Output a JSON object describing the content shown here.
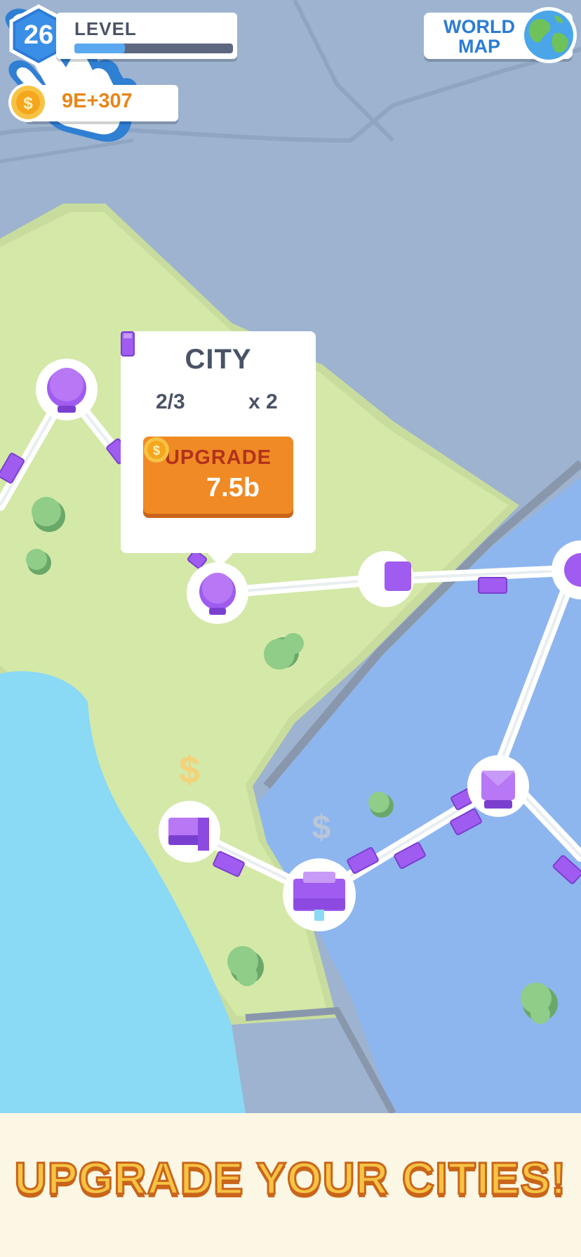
{
  "hud": {
    "level_number": "26",
    "level_label": "LEVEL",
    "level_progress": 0.32,
    "coins": "9E+307",
    "world_map_line1": "WORLD",
    "world_map_line2": "MAP"
  },
  "popup": {
    "title": "CITY",
    "progress": "2/3",
    "multiplier": "x 2",
    "upgrade_label": "UPGRADE",
    "upgrade_cost": "7.5b"
  },
  "banner": {
    "text": "UPGRADE YOUR CITIES!"
  },
  "colors": {
    "land": "#cfe6a5",
    "water_light": "#8ad9f5",
    "water_blue": "#8db6ef",
    "sea": "#9db3cf",
    "node_purple": "#a05cf0",
    "coin": "#f6a61c",
    "upgrade_button": "#f08a24"
  },
  "icons": [
    "coin-icon",
    "globe-icon",
    "truck-icon",
    "hand-pointer-icon",
    "dollar-icon",
    "tree-icon",
    "city-node-icon"
  ]
}
